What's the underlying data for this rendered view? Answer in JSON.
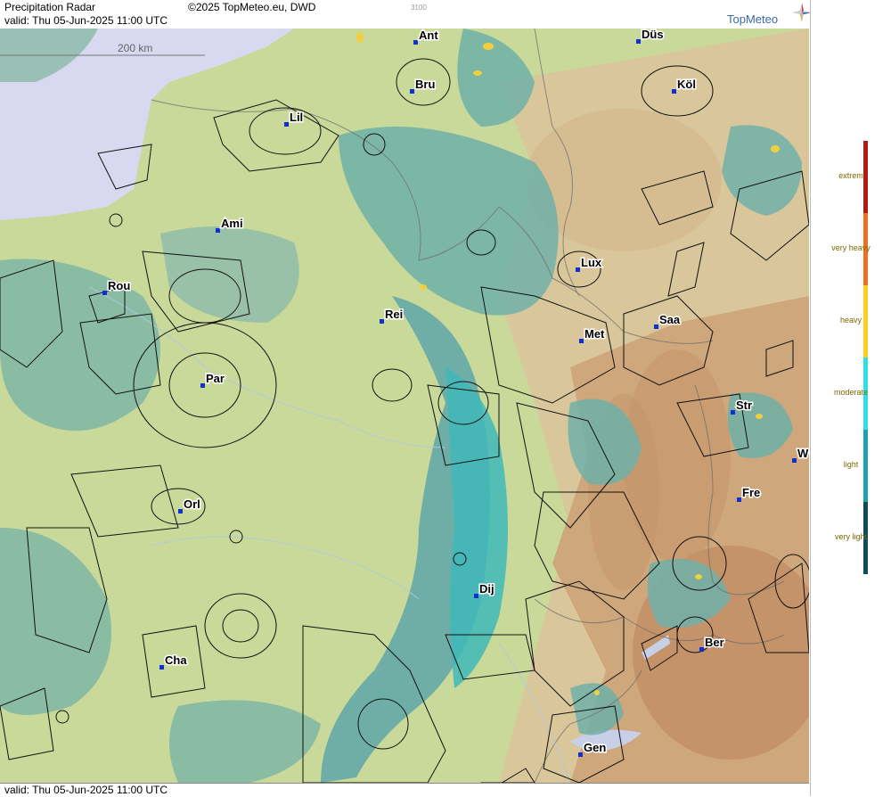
{
  "header": {
    "title": "Precipitation Radar",
    "copyright": "©2025 TopMeteo.eu, DWD",
    "valid": "valid:  Thu  05-Jun-2025 11:00 UTC",
    "code": "3100",
    "logo": "TopMeteo"
  },
  "footer": {
    "valid": "valid:  Thu  05-Jun-2025 11:00 UTC"
  },
  "scale": {
    "label": "200 km"
  },
  "legend": {
    "items": [
      {
        "label": "extrem",
        "color": "#b01a10"
      },
      {
        "label": "very heavy",
        "color": "#f07020"
      },
      {
        "label": "heavy",
        "color": "#f8d020"
      },
      {
        "label": "moderate",
        "color": "#30e0e0"
      },
      {
        "label": "light",
        "color": "#20a0a8"
      },
      {
        "label": "very light",
        "color": "#104a60"
      }
    ]
  },
  "cities": [
    {
      "name": "Ant"
    },
    {
      "name": "Düs"
    },
    {
      "name": "Bru"
    },
    {
      "name": "Köl"
    },
    {
      "name": "Lil"
    },
    {
      "name": "Ami"
    },
    {
      "name": "Lux"
    },
    {
      "name": "Rou"
    },
    {
      "name": "Rei"
    },
    {
      "name": "Saa"
    },
    {
      "name": "Met"
    },
    {
      "name": "Par"
    },
    {
      "name": "Str"
    },
    {
      "name": "W"
    },
    {
      "name": "Fre"
    },
    {
      "name": "Orl"
    },
    {
      "name": "Dij"
    },
    {
      "name": "Ber"
    },
    {
      "name": "Cha"
    },
    {
      "name": "Gen"
    }
  ],
  "colors": {
    "sea": "#d8d8f0",
    "lowland": "#c8dc9a",
    "hill": "#d8c490",
    "mountain": "#c89a70",
    "precip_light": "#20a8a8",
    "precip_moderate": "#40d8d0",
    "precip_very_light": "#5aa0a0"
  }
}
